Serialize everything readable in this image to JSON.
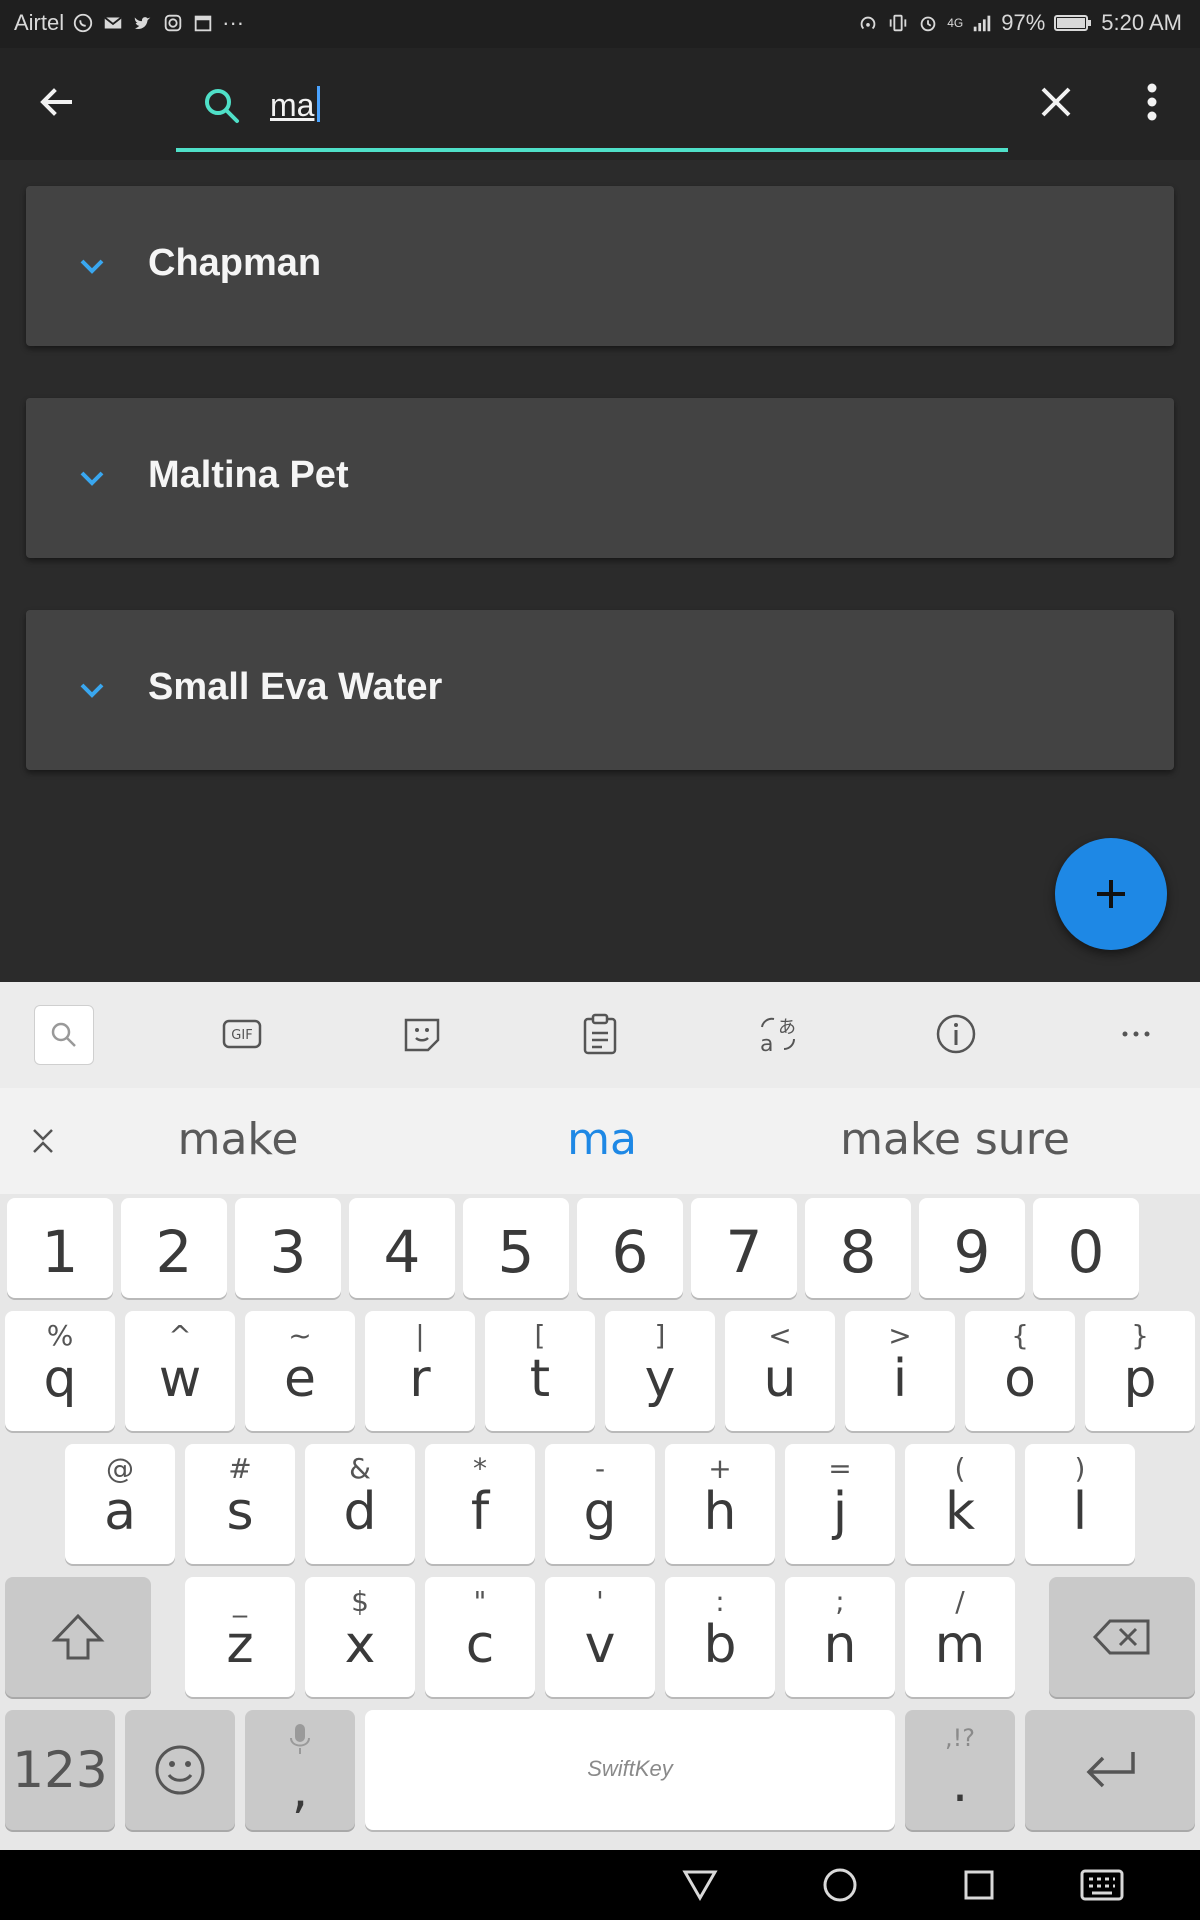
{
  "status_bar": {
    "carrier": "Airtel",
    "battery": "97%",
    "time": "5:20 AM",
    "network": "4G",
    "left_icons": [
      "whatsapp-icon",
      "mail-icon",
      "twitter-icon",
      "instagram-icon",
      "calendar-icon",
      "more-notifications-icon"
    ],
    "right_icons": [
      "hotspot-icon",
      "vibrate-icon",
      "alarm-icon",
      "signal-icon",
      "battery-icon"
    ]
  },
  "app_bar": {
    "search_value": "ma",
    "back_icon": "arrow-left-icon",
    "clear_icon": "close-icon",
    "menu_icon": "more-vertical-icon"
  },
  "results": [
    {
      "label": "Chapman"
    },
    {
      "label": "Maltina Pet"
    },
    {
      "label": "Small Eva Water"
    }
  ],
  "fab": {
    "icon": "plus-icon"
  },
  "keyboard": {
    "toolbar_icons": [
      "search-icon",
      "gif-icon",
      "sticker-icon",
      "clipboard-icon",
      "translate-icon",
      "info-icon",
      "more-horizontal-icon"
    ],
    "suggestions": [
      "make",
      "ma",
      "make sure"
    ],
    "number_row": [
      "1",
      "2",
      "3",
      "4",
      "5",
      "6",
      "7",
      "8",
      "9",
      "0"
    ],
    "row1": [
      {
        "main": "q",
        "sub": "%"
      },
      {
        "main": "w",
        "sub": "^"
      },
      {
        "main": "e",
        "sub": "~"
      },
      {
        "main": "r",
        "sub": "|"
      },
      {
        "main": "t",
        "sub": "["
      },
      {
        "main": "y",
        "sub": "]"
      },
      {
        "main": "u",
        "sub": "<"
      },
      {
        "main": "i",
        "sub": ">"
      },
      {
        "main": "o",
        "sub": "{"
      },
      {
        "main": "p",
        "sub": "}"
      }
    ],
    "row2": [
      {
        "main": "a",
        "sub": "@"
      },
      {
        "main": "s",
        "sub": "#"
      },
      {
        "main": "d",
        "sub": "&"
      },
      {
        "main": "f",
        "sub": "*"
      },
      {
        "main": "g",
        "sub": "-"
      },
      {
        "main": "h",
        "sub": "+"
      },
      {
        "main": "j",
        "sub": "="
      },
      {
        "main": "k",
        "sub": "("
      },
      {
        "main": "l",
        "sub": ")"
      }
    ],
    "row3": [
      {
        "main": "z",
        "sub": "_"
      },
      {
        "main": "x",
        "sub": "$"
      },
      {
        "main": "c",
        "sub": "\""
      },
      {
        "main": "v",
        "sub": "'"
      },
      {
        "main": "b",
        "sub": ":"
      },
      {
        "main": "n",
        "sub": ";"
      },
      {
        "main": "m",
        "sub": "/"
      }
    ],
    "symbols_key": "123",
    "comma_key": ",",
    "period_key": ".",
    "period_sub": ",!?",
    "spacebar_brand": "SwiftKey"
  },
  "nav_bar": {
    "icons": [
      "back-triangle-icon",
      "home-circle-icon",
      "recents-square-icon",
      "keyboard-icon"
    ]
  },
  "colors": {
    "accent": "#4fe0c8",
    "fab": "#1e88e5",
    "chevron": "#39a7f0",
    "suggestion_highlight": "#1e88e5"
  }
}
